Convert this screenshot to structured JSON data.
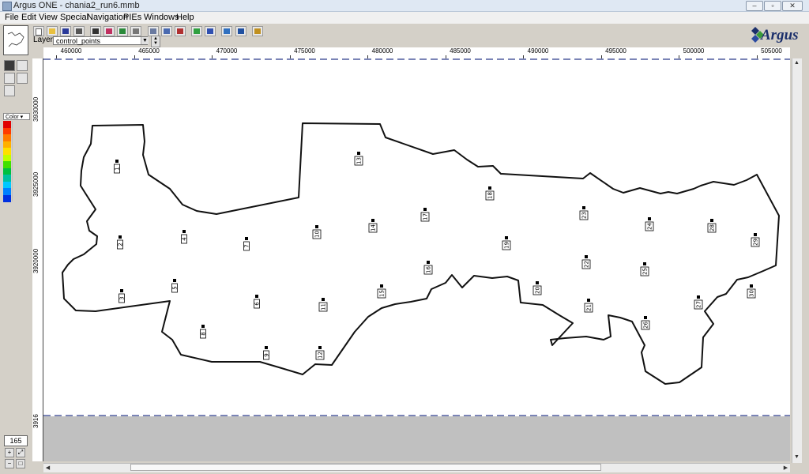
{
  "window": {
    "title": "Argus ONE - chania2_run6.mmb"
  },
  "menu": [
    "File",
    "Edit",
    "View",
    "Special",
    "Navigation",
    "PIEs",
    "Windows",
    "Help"
  ],
  "layer": {
    "label": "Layer:",
    "value": "control_points"
  },
  "logo": {
    "text": "Argus"
  },
  "color_panel": {
    "label": "Color"
  },
  "zoom_value": "165",
  "colors": {
    "legend": [
      "#e00000",
      "#ff3a00",
      "#ff7a00",
      "#ffb000",
      "#ffe000",
      "#c0ff00",
      "#40e000",
      "#00c040",
      "#00c0a0",
      "#00c8ff",
      "#0080ff",
      "#0030e0"
    ]
  },
  "ruler_x_labels": [
    "460000",
    "465000",
    "470000",
    "475000",
    "480000",
    "485000",
    "490000",
    "495000",
    "500000",
    "505000"
  ],
  "ruler_y_labels": [
    "3930000",
    "3925000",
    "3920000",
    "3916"
  ],
  "control_point_labels": [
    "1",
    "2",
    "3",
    "4",
    "5",
    "6",
    "7",
    "8",
    "9",
    "10",
    "11",
    "12",
    "13",
    "14",
    "15",
    "16",
    "17",
    "18",
    "19",
    "20",
    "21",
    "22",
    "23",
    "24",
    "25",
    "26",
    "27",
    "28",
    "29",
    "30"
  ]
}
